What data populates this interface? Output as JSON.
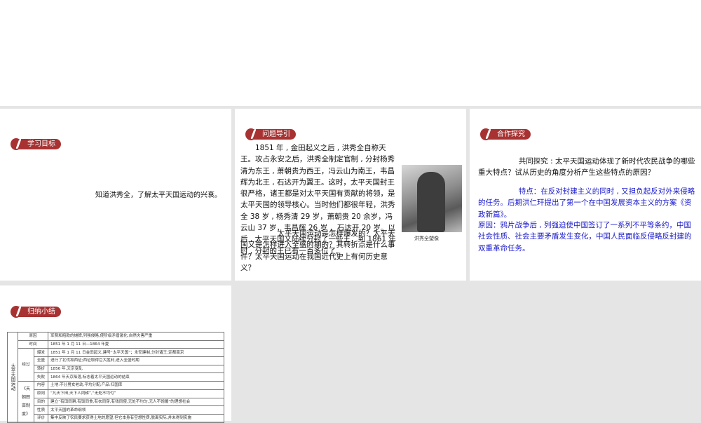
{
  "panels": {
    "goals": {
      "badge": "学习目标",
      "text": "知道洪秀全，了解太平天国运动的兴衰。"
    },
    "intro": {
      "badge": "问题导引",
      "para1": "1851 年 , 金田起义之后 , 洪秀全自称天王。攻占永安之后，洪秀全制定官制 , 分封杨秀清为东王 , 萧朝贵为西王，冯云山为南王，韦昌辉为北王 , 石达开为翼王。这时，太平天国封王很严格，诸王都是对太平天国有贡献的将领，是太平天国的领导核心。当时他们都很年轻，洪秀全 38 岁 , 杨秀清 29 岁，萧朝贵 20 余岁，冯云山 37 岁，韦昌辉 26 岁 ，石达开 20 岁。以后 , 太平天国又陆续分封了一些王，到 1861 年时 , 分封的王已有一百多位了。",
      "para2": "太平天国运动是怎样爆发的？太平天国又是怎样进入全盛时期的？其转折点是什么事件？太平天国运动在我国近代史上有何历史意义？",
      "photo_caption": "洪秀全塑像"
    },
    "explore": {
      "badge": "合作探究",
      "question": "共同探究 : 太平天国运动体现了新时代农民战争的哪些重大特点？试从历史的角度分析产生这些特点的原因？",
      "answer1": "特点：在反对封建主义的同时 , 又担负起反对外来侵略的任务。后期洪仁玕提出了第一个在中国发展资本主义的方案《资政新篇》。",
      "answer2": "原因：鸦片战争后 , 列强迫使中国签订了一系列不平等条约，中国社会性质、社会主要矛盾发生变化，中国人民面临反侵略反封建的双重革命任务。"
    },
    "summary": {
      "badge": "归纳小结",
      "table": {
        "title": "太平天国运动",
        "group_process": "经过",
        "group_system": "《天朝田亩制度》",
        "rows": [
          {
            "k": "原因",
            "v": "军费和赔款的摊牌,列强侵略,使阶级矛盾激化;自然灾害严重"
          },
          {
            "k": "时间",
            "v": "1851 年 1 月 11 日—1864 年夏"
          },
          {
            "k": "爆发",
            "v": "1851 年 1 月 11 日金田起义,建号“太平天国”；永安建制,分封诸王;定都南京"
          },
          {
            "k": "全盛",
            "v": "进行了北伐和西征;西征取得巨大胜利,进入全盛时期"
          },
          {
            "k": "转折",
            "v": "1856 年,天京变乱"
          },
          {
            "k": "失败",
            "v": "1864 年天京陷落,标志着太平天国运动的结束"
          },
          {
            "k": "内容",
            "v": "土地:不分男女老幼,平均分配;产品:归国库"
          },
          {
            "k": "原则",
            "v": "“凡天下田,天下人同耕”,“无处不均匀”"
          },
          {
            "k": "目的",
            "v": "建立“有田同耕,有饭同食,有衣同穿,有钱同使,无处不均匀,无人不饱暖”的理想社会"
          },
          {
            "k": "性质",
            "v": "太平天国的革命纲领"
          },
          {
            "k": "评价",
            "v": "集中反映了农民要求获得土地的愿望,但它本身有空想性质,脱离实际,并未得到实施"
          }
        ]
      }
    }
  },
  "colors": {
    "badge": "#a83232",
    "answer": "#1a1acc",
    "gap": "#e5e5e5"
  }
}
